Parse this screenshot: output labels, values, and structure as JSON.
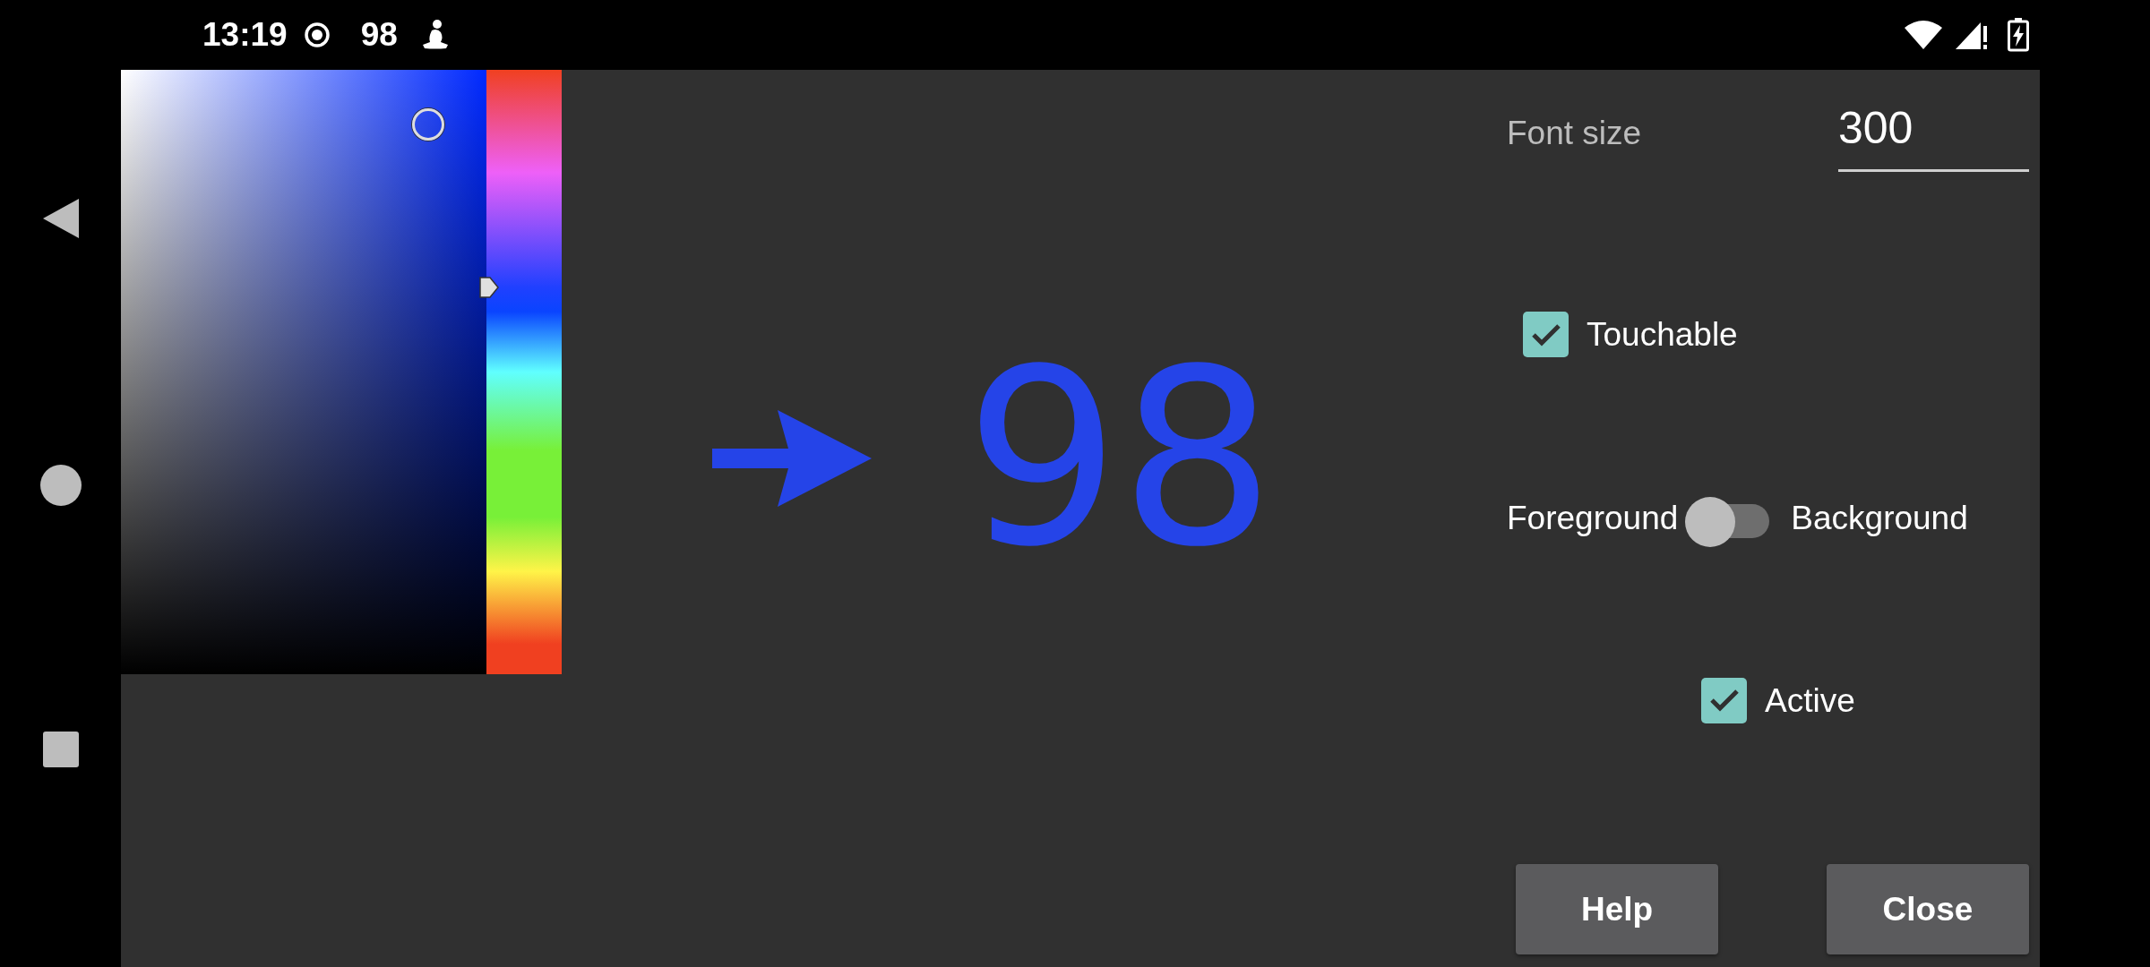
{
  "status_bar": {
    "time": "13:19",
    "notification_text": "98"
  },
  "preview": {
    "text": "98"
  },
  "font_size": {
    "label": "Font size",
    "value": "300"
  },
  "touchable": {
    "label": "Touchable",
    "checked": true
  },
  "color_target": {
    "left_label": "Foreground",
    "right_label": "Background",
    "on": false
  },
  "active": {
    "label": "Active",
    "checked": true
  },
  "buttons": [
    {
      "label": "Help"
    },
    {
      "label": "Close"
    }
  ]
}
